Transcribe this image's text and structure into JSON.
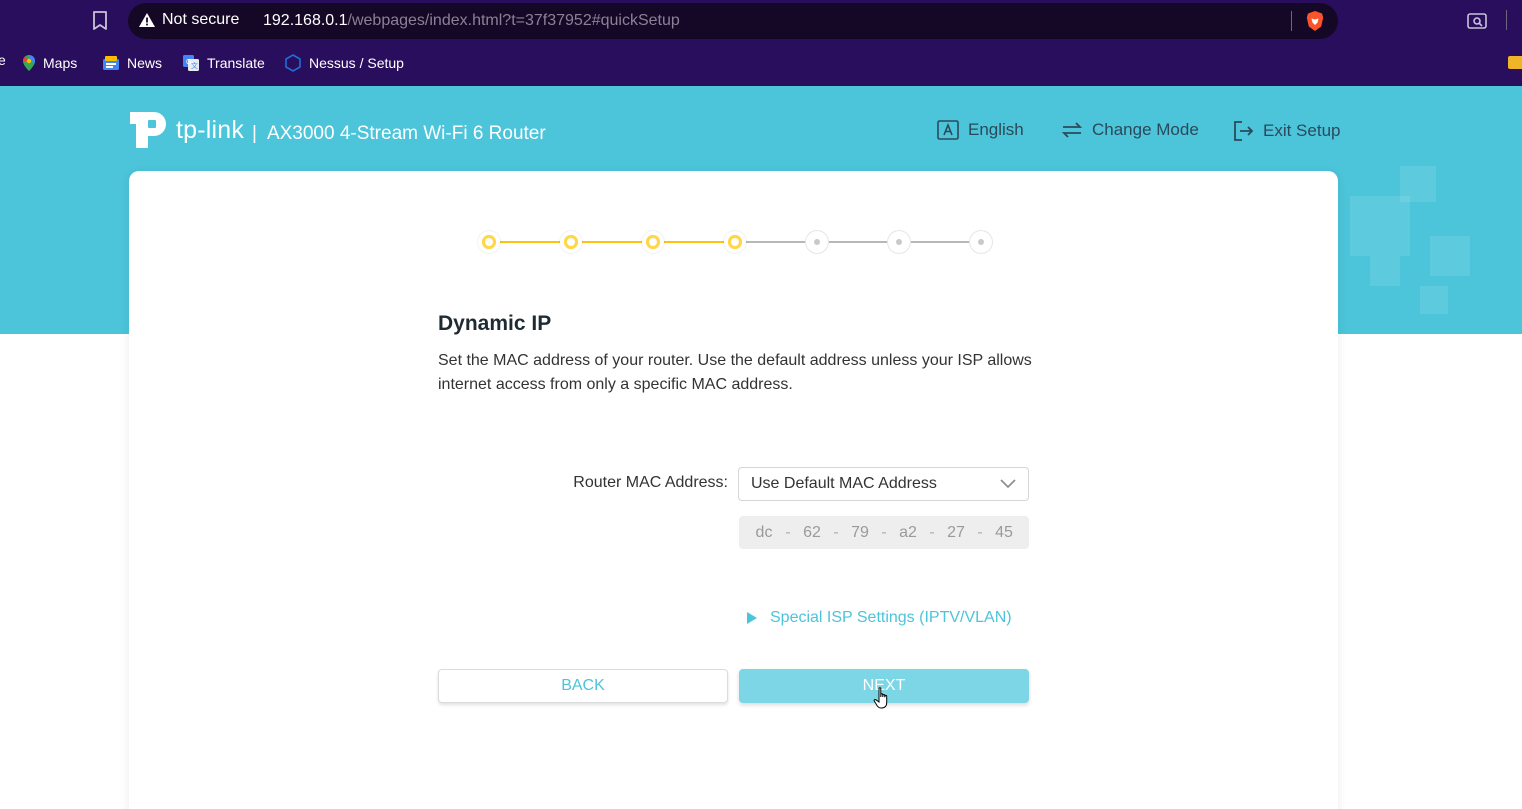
{
  "browser": {
    "security_label": "Not secure",
    "url_host": "192.168.0.1",
    "url_path": "/webpages/index.html?t=37f37952#quickSetup",
    "bookmarks": [
      {
        "label": "Maps",
        "icon": "maps-icon"
      },
      {
        "label": "News",
        "icon": "news-icon"
      },
      {
        "label": "Translate",
        "icon": "translate-icon"
      },
      {
        "label": "Nessus / Setup",
        "icon": "nessus-icon"
      }
    ],
    "colors": {
      "chrome": "#2a0e5e",
      "address_bar": "#150826"
    }
  },
  "header": {
    "logo_text": "tp-link",
    "separator": "|",
    "model": "AX3000 4-Stream Wi-Fi 6 Router",
    "links": [
      {
        "label": "English",
        "icon": "language-icon"
      },
      {
        "label": "Change Mode",
        "icon": "change-mode-icon"
      },
      {
        "label": "Exit Setup",
        "icon": "exit-icon"
      }
    ]
  },
  "stepper": {
    "total_steps": 7,
    "completed_steps": 4
  },
  "content": {
    "title": "Dynamic IP",
    "description": "Set the MAC address of your router. Use the default address unless your ISP allows internet access from only a specific MAC address.",
    "mac_field_label": "Router MAC Address:",
    "mac_select_value": "Use Default MAC Address",
    "mac_octets": [
      "dc",
      "62",
      "79",
      "a2",
      "27",
      "45"
    ],
    "mac_separator": "-",
    "isp_link": "Special ISP Settings (IPTV/VLAN)"
  },
  "buttons": {
    "back": "BACK",
    "next": "NEXT"
  },
  "colors": {
    "accent": "#4cc4da",
    "step_active": "#fcc20d",
    "step_inactive": "#c9c9c9",
    "next_button": "#7cd6e6"
  }
}
